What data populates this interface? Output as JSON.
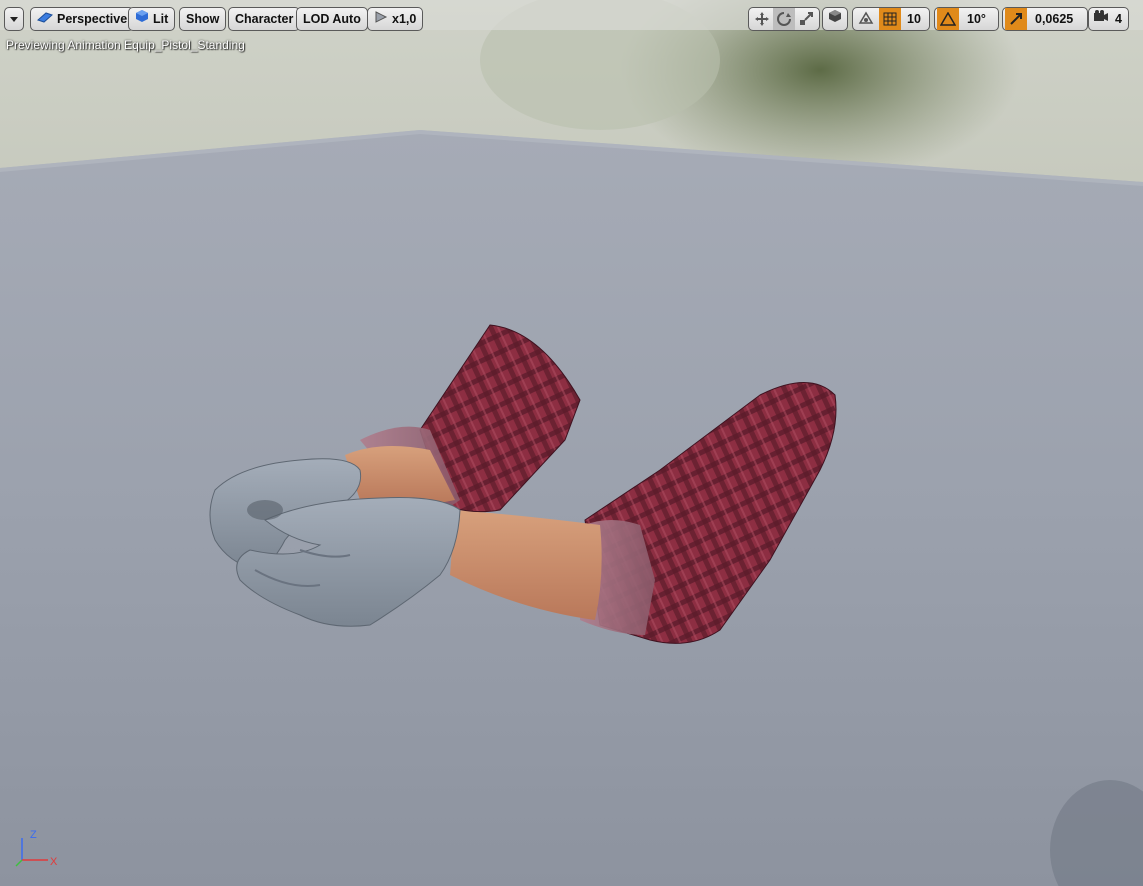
{
  "toolbar": {
    "dropdown_icon": "chevron-down-icon",
    "perspective_label": "Perspective",
    "lit_label": "Lit",
    "show_label": "Show",
    "character_label": "Character",
    "lod_label": "LOD Auto",
    "play_speed_label": "x1,0",
    "grid_snap_value": "10",
    "rotation_snap_value": "10°",
    "scale_snap_value": "0,0625",
    "camera_speed_value": "4"
  },
  "viewport": {
    "preview_text": "Previewing Animation Equip_Pistol_Standing",
    "axis": {
      "z": "Z",
      "x": "X"
    }
  },
  "colors": {
    "accent_orange": "#e08a1a",
    "button_bg": "#dcdcdc",
    "floor": "#9aa0ab",
    "sleeve": "#8a2f3e",
    "glove": "#8c96a3",
    "skin": "#c98d68"
  }
}
